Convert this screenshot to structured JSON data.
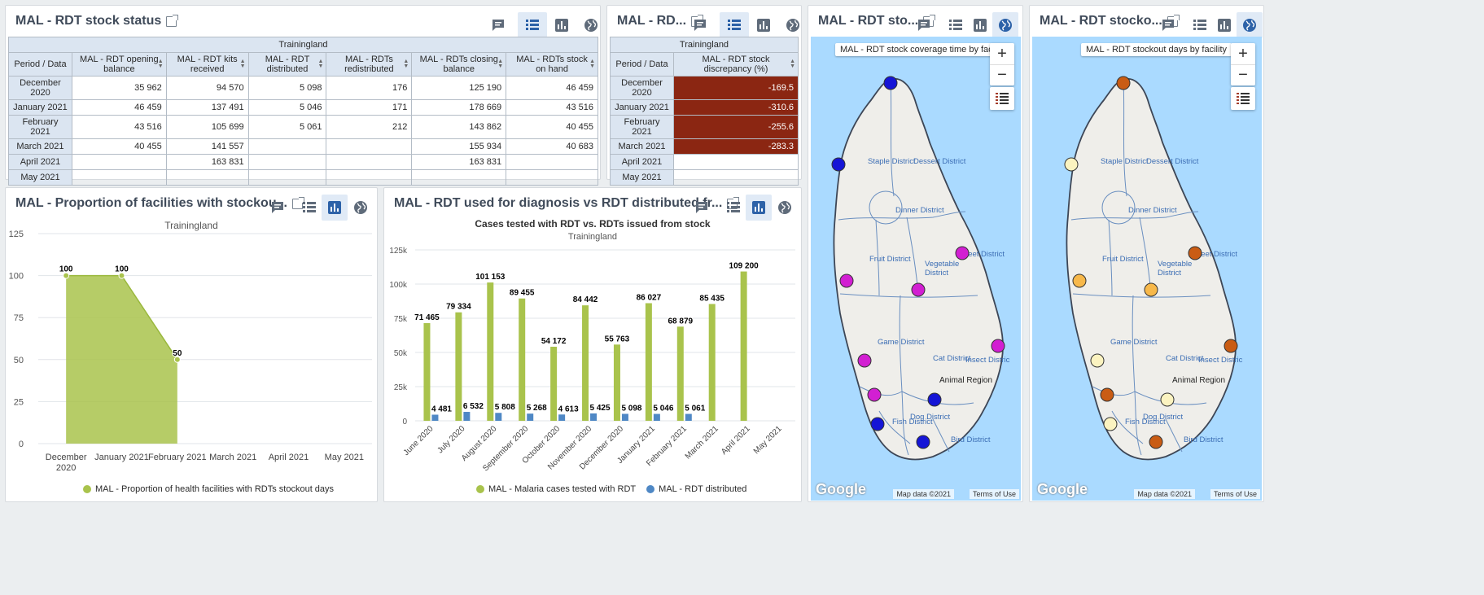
{
  "colors": {
    "green": "#a9c34c",
    "blue": "#4f88c5",
    "discrepancy": "#8b2612",
    "header_bg": "#dbe5f1",
    "tb_selected": "#e0eaf6",
    "icon": "#5f6b7a",
    "sea": "#aadaff",
    "land": "#efeeea"
  },
  "panel1": {
    "title": "MAL - RDT stock status",
    "org": "Trainingland",
    "corner": "Period / Data",
    "columns": [
      "MAL - RDT opening balance",
      "MAL - RDT kits received",
      "MAL - RDT distributed",
      "MAL - RDTs redistributed",
      "MAL - RDTs closing balance",
      "MAL - RDTs stock on hand"
    ],
    "rows": [
      {
        "period": "December 2020",
        "cells": [
          "35 962",
          "94 570",
          "5 098",
          "176",
          "125 190",
          "46 459"
        ]
      },
      {
        "period": "January 2021",
        "cells": [
          "46 459",
          "137 491",
          "5 046",
          "171",
          "178 669",
          "43 516"
        ]
      },
      {
        "period": "February 2021",
        "cells": [
          "43 516",
          "105 699",
          "5 061",
          "212",
          "143 862",
          "40 455"
        ]
      },
      {
        "period": "March 2021",
        "cells": [
          "40 455",
          "141 557",
          "",
          "",
          "155 934",
          "40 683"
        ]
      },
      {
        "period": "April 2021",
        "cells": [
          "",
          "163 831",
          "",
          "",
          "163 831",
          ""
        ]
      },
      {
        "period": "May 2021",
        "cells": [
          "",
          "",
          "",
          "",
          "",
          ""
        ]
      }
    ]
  },
  "panel2": {
    "title": "MAL - RD...",
    "org": "Trainingland",
    "corner": "Period / Data",
    "column": "MAL - RDT stock discrepancy (%)",
    "rows": [
      {
        "period": "December 2020",
        "value": "-169.5"
      },
      {
        "period": "January 2021",
        "value": "-310.6"
      },
      {
        "period": "February 2021",
        "value": "-255.6"
      },
      {
        "period": "March 2021",
        "value": "-283.3"
      },
      {
        "period": "April 2021",
        "value": ""
      },
      {
        "period": "May 2021",
        "value": ""
      }
    ]
  },
  "panel3": {
    "title": "MAL - RDT sto...",
    "map_label": "MAL - RDT stock coverage time by facility",
    "zoom_in": "+",
    "zoom_out": "−",
    "map_data": "Map data ©2021",
    "terms": "Terms of Use",
    "google": "Google",
    "region": "Animal Region"
  },
  "panel4": {
    "title": "MAL - RDT stocko...",
    "map_label": "MAL - RDT stockout days by facility",
    "zoom_in": "+",
    "zoom_out": "−",
    "map_data": "Map data ©2021",
    "terms": "Terms of Use",
    "google": "Google",
    "region": "Animal Region"
  },
  "districts": [
    "Staple District",
    "Dessert District",
    "Dinner District",
    "Fruit District",
    "Vegetable District",
    "Sweet District",
    "Game District",
    "Cat District",
    "Insect Distric",
    "Dog District",
    "Fish District",
    "Bird District"
  ],
  "panel5": {
    "title": "MAL - Proportion of facilities with stockou...",
    "subtitle": "Trainingland",
    "legend": "MAL - Proportion of health facilities with RDTs stockout days"
  },
  "panel6": {
    "title": "MAL - RDT used for diagnosis vs RDT distributed fr...",
    "chart_title": "Cases tested with RDT vs. RDTs issued from stock",
    "subtitle": "Trainingland",
    "legend_green": "MAL - Malaria cases tested with RDT",
    "legend_blue": "MAL - RDT distributed"
  },
  "chart_data": [
    {
      "type": "area",
      "title": "",
      "subtitle": "Trainingland",
      "categories": [
        "December 2020",
        "January 2021",
        "February 2021",
        "March 2021",
        "April 2021",
        "May 2021"
      ],
      "category_lines": [
        [
          "December",
          "2020"
        ],
        [
          "January 2021"
        ],
        [
          "February 2021"
        ],
        [
          "March 2021"
        ],
        [
          "April 2021"
        ],
        [
          "May 2021"
        ]
      ],
      "series": [
        {
          "name": "MAL - Proportion of health facilities with RDTs stockout days",
          "values": [
            100,
            100,
            50,
            null,
            null,
            null
          ]
        }
      ],
      "data_labels": [
        "100",
        "100",
        "50",
        "",
        "",
        ""
      ],
      "ylim": [
        0,
        125
      ],
      "yticks": [
        0,
        25,
        50,
        75,
        100,
        125
      ],
      "ytick_labels": [
        "0",
        "25",
        "50",
        "75",
        "100",
        "125"
      ],
      "grid": true,
      "legend": "bottom"
    },
    {
      "type": "bar",
      "title": "Cases tested with RDT vs. RDTs issued from stock",
      "subtitle": "Trainingland",
      "categories": [
        "June 2020",
        "July 2020",
        "August 2020",
        "September 2020",
        "October 2020",
        "November 2020",
        "December 2020",
        "January 2021",
        "February 2021",
        "March 2021",
        "April 2021",
        "May 2021"
      ],
      "series": [
        {
          "name": "MAL - Malaria cases tested with RDT",
          "values": [
            71465,
            79334,
            101153,
            89455,
            54172,
            84442,
            55763,
            86027,
            68879,
            85435,
            109200,
            null
          ],
          "labels": [
            "71 465",
            "79 334",
            "101 153",
            "89 455",
            "54 172",
            "84 442",
            "55 763",
            "86 027",
            "68 879",
            "85 435",
            "109 200",
            ""
          ]
        },
        {
          "name": "MAL - RDT distributed",
          "values": [
            4481,
            6532,
            5808,
            5268,
            4613,
            5425,
            5098,
            5046,
            5061,
            null,
            null,
            null
          ],
          "labels": [
            "4 481",
            "6 532",
            "5 808",
            "5 268",
            "4 613",
            "5 425",
            "5 098",
            "5 046",
            "5 061",
            "",
            "",
            ""
          ]
        }
      ],
      "ylim": [
        0,
        125000
      ],
      "yticks": [
        0,
        25000,
        50000,
        75000,
        100000,
        125000
      ],
      "ytick_labels": [
        "0",
        "25k",
        "50k",
        "75k",
        "100k",
        "125k"
      ],
      "grid": true,
      "legend": "bottom"
    }
  ]
}
